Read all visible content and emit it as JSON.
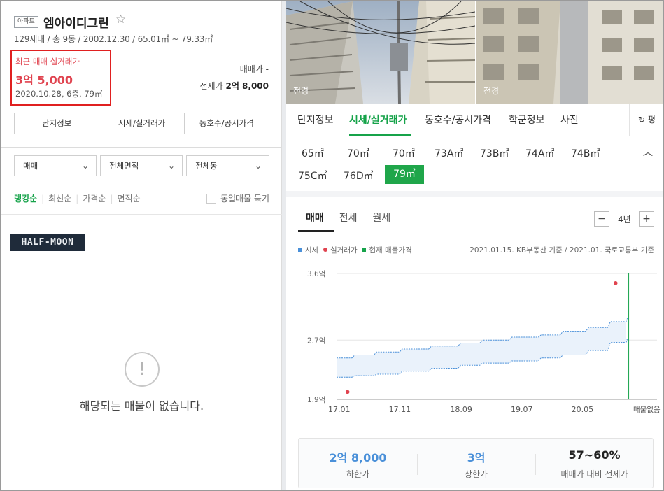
{
  "listing": {
    "type_tag": "아파트",
    "name": "엠아이디그린",
    "meta": "129세대 / 총 9동 / 2002.12.30 / 65.01㎡ ~ 79.33㎡",
    "recent_label": "최근 매매 실거래가",
    "recent_price": "3억 5,000",
    "recent_date": "2020.10.28, 6층, 79㎡",
    "sale_price": "매매가 -",
    "jeonse_label": "전세가",
    "jeonse_value": "2억 8,000"
  },
  "left_tabs": [
    "단지정보",
    "시세/실거래가",
    "동호수/공시가격"
  ],
  "filters": {
    "trade": "매매",
    "area": "전체면적",
    "dong": "전체동"
  },
  "sorts": [
    "랭킹순",
    "최신순",
    "가격순",
    "면적순"
  ],
  "same_option": "동일매물 묶기",
  "banner_text": "HALF-MOON",
  "empty_message": "해당되는 매물이 없습니다.",
  "photos": [
    {
      "caption": "전경"
    },
    {
      "caption": "전경"
    }
  ],
  "right_tabs": [
    "단지정보",
    "시세/실거래가",
    "동호수/공시가격",
    "학군정보",
    "사진"
  ],
  "refresh_label": "평",
  "sizes": [
    "65㎡",
    "70㎡",
    "70㎡",
    "73A㎡",
    "73B㎡",
    "74A㎡",
    "74B㎡",
    "75C㎡",
    "76D㎡",
    "79㎡"
  ],
  "active_size": "79㎡",
  "chart_tabs": [
    "매매",
    "전세",
    "월세"
  ],
  "period": "4년",
  "legend": [
    "시세",
    "실거래가",
    "현재 매물가격"
  ],
  "basis": "2021.01.15. KB부동산 기준 / 2021.01. 국토교통부 기준",
  "colors": {
    "accent": "#16a34a",
    "price_red": "#e0434f",
    "band_blue": "#4a90d9"
  },
  "chart_data": {
    "type": "area",
    "x_ticks": [
      "17.01",
      "17.11",
      "18.09",
      "19.07",
      "20.05"
    ],
    "x_tail_label": "매물없음",
    "y_ticks": [
      "1.9억",
      "2.7억",
      "3.6억"
    ],
    "ylim": [
      1.9,
      3.6
    ],
    "xlim": [
      2017.0,
      2021.1
    ],
    "band": {
      "name": "시세",
      "x": [
        2017.0,
        2017.25,
        2017.55,
        2017.9,
        2018.3,
        2018.7,
        2019.0,
        2019.4,
        2019.8,
        2020.1,
        2020.45,
        2020.75,
        2021.0
      ],
      "lower": [
        2.2,
        2.22,
        2.24,
        2.28,
        2.32,
        2.36,
        2.39,
        2.42,
        2.46,
        2.5,
        2.56,
        2.67,
        2.71
      ],
      "upper": [
        2.46,
        2.5,
        2.54,
        2.58,
        2.62,
        2.66,
        2.7,
        2.74,
        2.77,
        2.82,
        2.87,
        2.95,
        2.99
      ]
    },
    "actual": {
      "name": "실거래가",
      "points": [
        [
          2017.15,
          2.0
        ],
        [
          2020.82,
          3.47
        ]
      ]
    },
    "current_marker": {
      "name": "현재 매물가격",
      "x": 2021.0
    }
  },
  "stats": [
    {
      "value": "2억 8,000",
      "label": "하한가",
      "color": "#4a90d9"
    },
    {
      "value": "3억",
      "label": "상한가",
      "color": "#4a90d9"
    },
    {
      "value": "57~60%",
      "label": "매매가 대비 전세가",
      "color": "#222"
    }
  ]
}
